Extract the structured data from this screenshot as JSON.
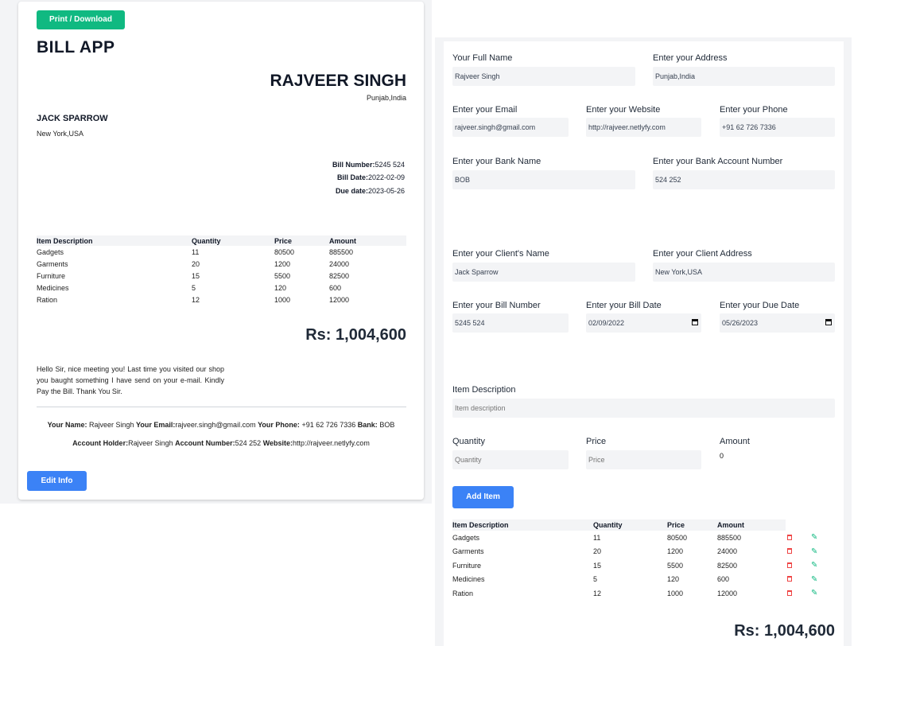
{
  "invoice": {
    "print_button": "Print / Download",
    "app_title": "BILL APP",
    "owner_name": "RAJVEER SINGH",
    "owner_address": "Punjab,India",
    "client_name": "JACK SPARROW",
    "client_address": "New York,USA",
    "bill_number_label": "Bill Number:",
    "bill_number": "5245 524",
    "bill_date_label": "Bill Date:",
    "bill_date": "2022-02-09",
    "due_date_label": "Due date:",
    "due_date": "2023-05-26",
    "headers": [
      "Item Description",
      "Quantity",
      "Price",
      "Amount"
    ],
    "rows": [
      [
        "Gadgets",
        "11",
        "80500",
        "885500"
      ],
      [
        "Garments",
        "20",
        "1200",
        "24000"
      ],
      [
        "Furniture",
        "15",
        "5500",
        "82500"
      ],
      [
        "Medicines",
        "5",
        "120",
        "600"
      ],
      [
        "Ration",
        "12",
        "1000",
        "12000"
      ]
    ],
    "total": "Rs: 1,004,600",
    "notes": "Hello Sir, nice meeting you! Last time you visited our shop you baught something I have send on your e-mail. Kindly Pay the Bill. Thank You Sir.",
    "footer": {
      "your_name_label": "Your Name:",
      "your_name": "Rajveer Singh",
      "email_label": "Your Email:",
      "email": "rajveer.singh@gmail.com",
      "phone_label": "Your Phone:",
      "phone": "+91 62 726 7336",
      "bank_label": "Bank:",
      "bank": "BOB",
      "account_holder_label": "Account Holder:",
      "account_holder": "Rajveer Singh",
      "account_number_label": "Account Number:",
      "account_number": "524 252",
      "website_label": "Website:",
      "website": "http://rajveer.netlyfy.com"
    },
    "edit_button": "Edit Info"
  },
  "form": {
    "full_name_label": "Your Full Name",
    "full_name": "Rajveer Singh",
    "address_label": "Enter your Address",
    "address": "Punjab,India",
    "email_label": "Enter your Email",
    "email": "rajveer.singh@gmail.com",
    "website_label": "Enter your Website",
    "website": "http://rajveer.netlyfy.com",
    "phone_label": "Enter your Phone",
    "phone": "+91 62 726 7336",
    "bank_name_label": "Enter your Bank Name",
    "bank_name": "BOB",
    "bank_account_label": "Enter your Bank Account Number",
    "bank_account": "524 252",
    "client_name_label": "Enter your Client's Name",
    "client_name": "Jack Sparrow",
    "client_address_label": "Enter your Client Address",
    "client_address": "New York,USA",
    "bill_number_label": "Enter your Bill Number",
    "bill_number": "5245 524",
    "bill_date_label": "Enter your Bill Date",
    "bill_date": "02/09/2022",
    "due_date_label": "Enter your Due Date",
    "due_date": "05/26/2023",
    "item_description_label": "Item Description",
    "item_description_placeholder": "Item description",
    "quantity_label": "Quantity",
    "quantity_placeholder": "Quantity",
    "price_label": "Price",
    "price_placeholder": "Price",
    "amount_label": "Amount",
    "amount_value": "0",
    "add_item_button": "Add Item",
    "headers": [
      "Item Description",
      "Quantity",
      "Price",
      "Amount"
    ],
    "rows": [
      [
        "Gadgets",
        "11",
        "80500",
        "885500"
      ],
      [
        "Garments",
        "20",
        "1200",
        "24000"
      ],
      [
        "Furniture",
        "15",
        "5500",
        "82500"
      ],
      [
        "Medicines",
        "5",
        "120",
        "600"
      ],
      [
        "Ration",
        "12",
        "1000",
        "12000"
      ]
    ],
    "total": "Rs: 1,004,600"
  },
  "icons": {
    "delete": "trash-icon",
    "edit": "pencil-icon",
    "calendar": "calendar-icon"
  },
  "colors": {
    "print_button": "#10b981",
    "primary_button": "#3b82f6",
    "delete_icon": "#ef4444",
    "edit_icon": "#10b981",
    "panel_bg": "#f3f4f6",
    "input_bg": "#f3f4f6"
  }
}
